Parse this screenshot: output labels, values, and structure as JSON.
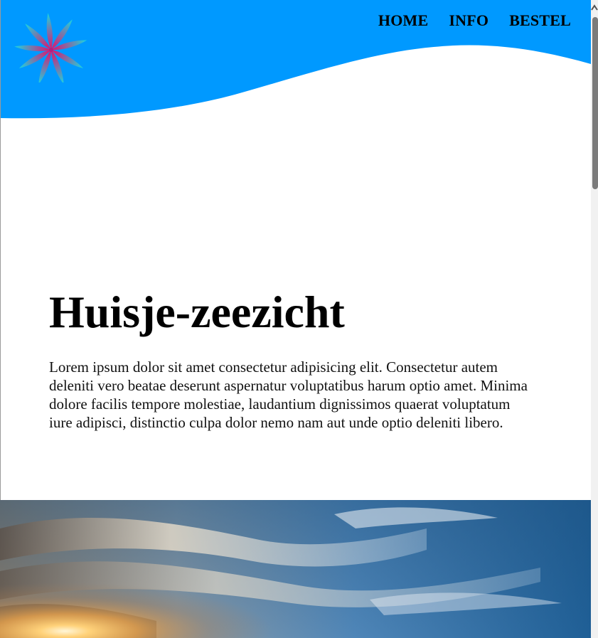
{
  "nav": {
    "items": [
      "HOME",
      "INFO",
      "BESTEL"
    ]
  },
  "main": {
    "title": "Huisje-zeezicht",
    "intro": "Lorem ipsum dolor sit amet consectetur adipisicing elit. Consectetur autem deleniti vero beatae deserunt aspernatur voluptatibus harum optio amet. Minima dolore facilis tempore molestiae, laudantium dignissimos quaerat voluptatum iure adipisci, distinctio culpa dolor nemo nam aut unde optio deleniti libero."
  },
  "icons": {
    "logo": "flower-logo-icon",
    "hero": "sunset-sky-image"
  },
  "colors": {
    "header": "#0099ff",
    "logo_gradient": [
      "#1ad6e0",
      "#e0106e"
    ],
    "text": "#000000",
    "background": "#ffffff"
  }
}
